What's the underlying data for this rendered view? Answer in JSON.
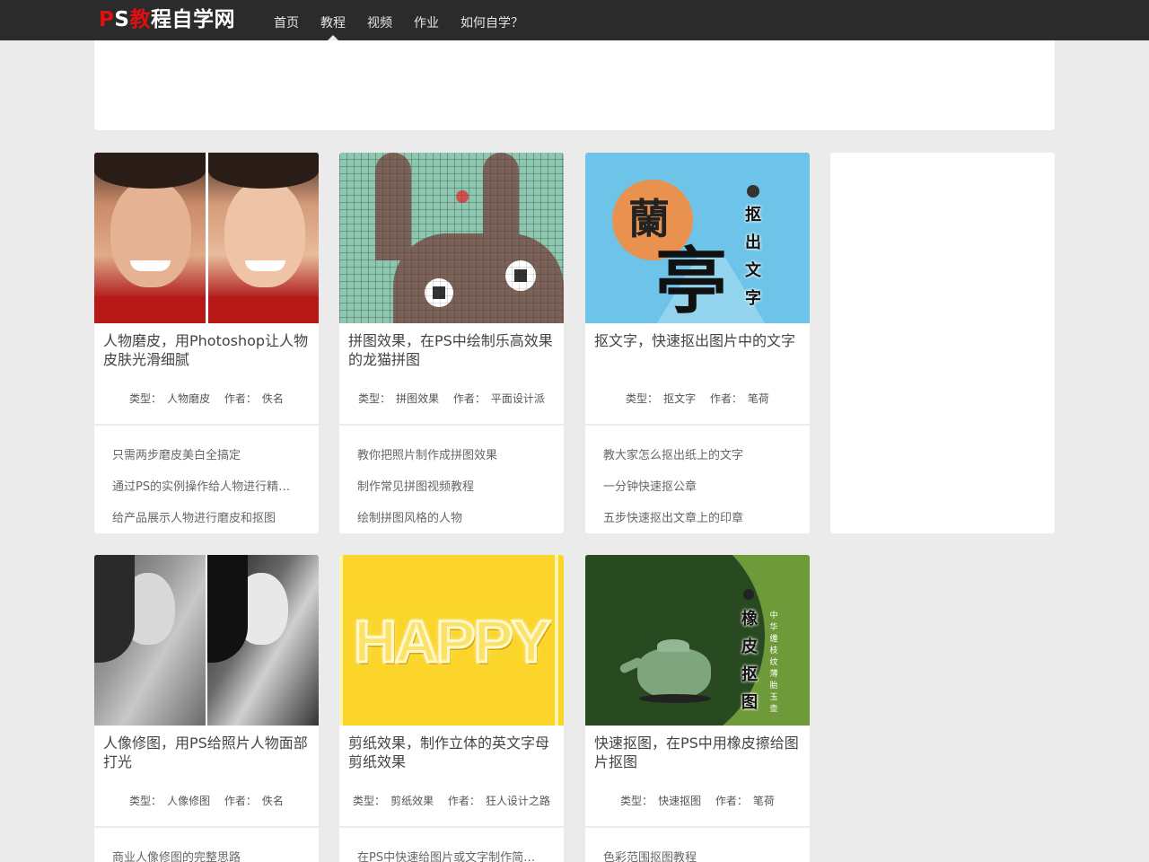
{
  "header": {
    "logo": {
      "p": "P",
      "s": "S",
      "jiao": "教",
      "rest": "程自学网"
    },
    "nav": [
      "首页",
      "教程",
      "视频",
      "作业",
      "如何自学？"
    ],
    "active_nav": "教程"
  },
  "labels": {
    "type_prefix": "类型：",
    "author_prefix": "作者："
  },
  "cards": [
    {
      "title": "人物磨皮，用Photoshop让人物皮肤光滑细腻",
      "type": "人物磨皮",
      "author": "佚名",
      "links": [
        "只需两步磨皮美白全搞定",
        "通过PS的实例操作给人物进行精…",
        "给产品展示人物进行磨皮和抠图"
      ]
    },
    {
      "title": "拼图效果，在PS中绘制乐高效果的龙猫拼图",
      "type": "拼图效果",
      "author": "平面设计派",
      "links": [
        "教你把照片制作成拼图效果",
        "制作常见拼图视频教程",
        "绘制拼图风格的人物"
      ]
    },
    {
      "title": "抠文字，快速抠出图片中的文字",
      "type": "抠文字",
      "author": "笔荷",
      "thumb_text": {
        "circle": "蘭",
        "big": "亭",
        "side": [
          "抠",
          "出",
          "文",
          "字"
        ]
      },
      "links": [
        "教大家怎么抠出纸上的文字",
        "一分钟快速抠公章",
        "五步快速抠出文章上的印章"
      ]
    },
    {
      "title": "人像修图，用PS给照片人物面部打光",
      "type": "人像修图",
      "author": "佚名",
      "links": [
        "商业人像修图的完整思路"
      ]
    },
    {
      "title": "剪纸效果，制作立体的英文字母剪纸效果",
      "type": "剪纸效果",
      "author": "狂人设计之路",
      "thumb_text": {
        "word": "HAPPY"
      },
      "links": [
        "在PS中快速给图片或文字制作简…"
      ]
    },
    {
      "title": "快速抠图，在PS中用橡皮擦给图片抠图",
      "type": "快速抠图",
      "author": "笔荷",
      "thumb_text": {
        "side": [
          "橡",
          "皮",
          "抠",
          "图"
        ],
        "small": [
          "中",
          "华",
          "缠",
          "枝",
          "纹",
          "薄",
          "胎",
          "玉",
          "壶"
        ]
      },
      "links": [
        "色彩范围抠图教程"
      ]
    }
  ],
  "colors": {
    "header_bg": "#2b2b2b",
    "logo_red": "#e01010",
    "page_bg": "#ebebeb"
  }
}
